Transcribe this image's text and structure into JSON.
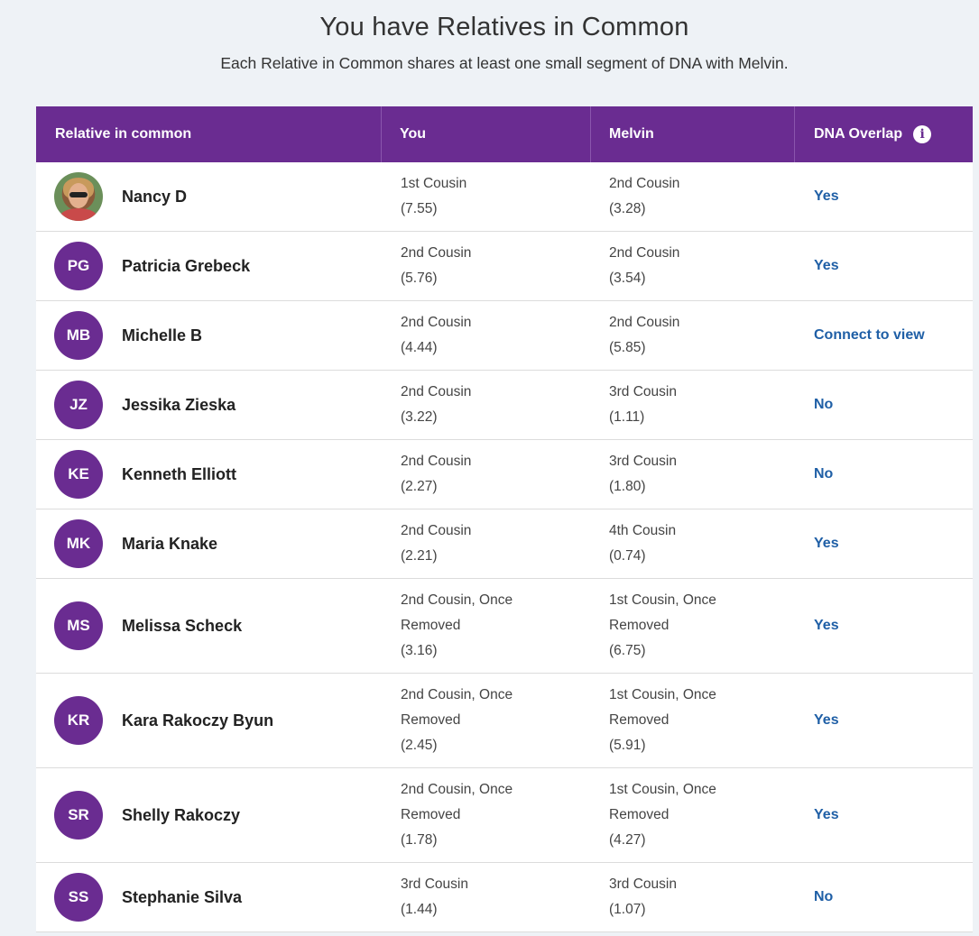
{
  "header": {
    "title": "You have Relatives in Common",
    "subtitle": "Each Relative in Common shares at least one small segment of DNA with Melvin."
  },
  "table": {
    "columns": [
      "Relative in common",
      "You",
      "Melvin",
      "DNA Overlap"
    ],
    "rows": [
      {
        "initials": "",
        "photo": true,
        "name": "Nancy D",
        "you": [
          "1st Cousin",
          "(7.55)"
        ],
        "melvin": [
          "2nd Cousin",
          "(3.28)"
        ],
        "overlap": "Yes"
      },
      {
        "initials": "PG",
        "name": "Patricia Grebeck",
        "you": [
          "2nd Cousin",
          "(5.76)"
        ],
        "melvin": [
          "2nd Cousin",
          "(3.54)"
        ],
        "overlap": "Yes"
      },
      {
        "initials": "MB",
        "name": "Michelle B",
        "you": [
          "2nd Cousin",
          "(4.44)"
        ],
        "melvin": [
          "2nd Cousin",
          "(5.85)"
        ],
        "overlap": "Connect to view"
      },
      {
        "initials": "JZ",
        "name": "Jessika Zieska",
        "you": [
          "2nd Cousin",
          "(3.22)"
        ],
        "melvin": [
          "3rd Cousin",
          "(1.11)"
        ],
        "overlap": "No"
      },
      {
        "initials": "KE",
        "name": "Kenneth Elliott",
        "you": [
          "2nd Cousin",
          "(2.27)"
        ],
        "melvin": [
          "3rd Cousin",
          "(1.80)"
        ],
        "overlap": "No"
      },
      {
        "initials": "MK",
        "name": "Maria Knake",
        "you": [
          "2nd Cousin",
          "(2.21)"
        ],
        "melvin": [
          "4th Cousin",
          "(0.74)"
        ],
        "overlap": "Yes"
      },
      {
        "initials": "MS",
        "name": "Melissa Scheck",
        "you": [
          "2nd Cousin, Once",
          "Removed",
          "(3.16)"
        ],
        "melvin": [
          "1st Cousin, Once",
          "Removed",
          "(6.75)"
        ],
        "overlap": "Yes"
      },
      {
        "initials": "KR",
        "name": "Kara Rakoczy Byun",
        "you": [
          "2nd Cousin, Once",
          "Removed",
          "(2.45)"
        ],
        "melvin": [
          "1st Cousin, Once",
          "Removed",
          "(5.91)"
        ],
        "overlap": "Yes"
      },
      {
        "initials": "SR",
        "name": "Shelly Rakoczy",
        "you": [
          "2nd Cousin, Once",
          "Removed",
          "(1.78)"
        ],
        "melvin": [
          "1st Cousin, Once",
          "Removed",
          "(4.27)"
        ],
        "overlap": "Yes"
      },
      {
        "initials": "SS",
        "name": "Stephanie Silva",
        "you": [
          "3rd Cousin",
          "(1.44)"
        ],
        "melvin": [
          "3rd Cousin",
          "(1.07)"
        ],
        "overlap": "No"
      }
    ]
  },
  "colors": {
    "header_bg": "#6a2c91",
    "link": "#1f5fa6",
    "page_bg": "#eef2f6"
  },
  "icons": {
    "info": "info-icon"
  }
}
